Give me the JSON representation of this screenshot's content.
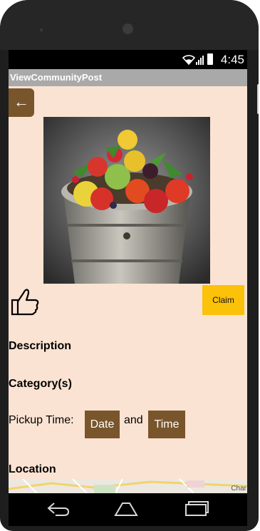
{
  "status_bar": {
    "time": "4:45"
  },
  "app": {
    "title": "ViewCommunityPost"
  },
  "buttons": {
    "back": "←",
    "claim": "Claim",
    "date": "Date",
    "time": "Time"
  },
  "labels": {
    "description": "Description",
    "categories": "Category(s)",
    "pickup_time": "Pickup Time:",
    "and": "and",
    "location": "Location"
  },
  "map": {
    "visible_text": "Char"
  },
  "icons": [
    "wifi-icon",
    "signal-icon",
    "battery-icon",
    "thumbs-up-icon",
    "nav-back-icon",
    "nav-home-icon",
    "nav-recent-icon"
  ],
  "colors": {
    "background": "#fbe3d3",
    "button_brown": "#79552b",
    "claim_yellow": "#fcc109",
    "titlebar": "#a9a9a9"
  }
}
